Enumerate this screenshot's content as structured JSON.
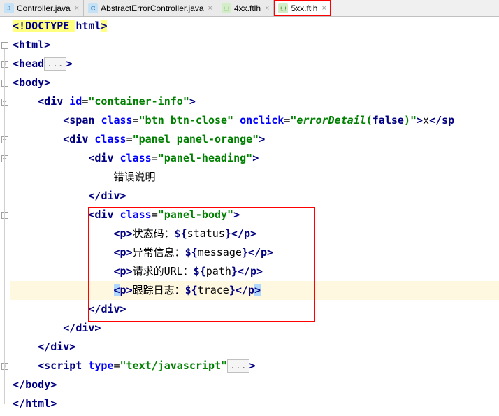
{
  "tabs": [
    {
      "label": "Controller.java",
      "icon": "J",
      "iconClass": "java",
      "active": false,
      "closeable": true
    },
    {
      "label": "AbstractErrorController.java",
      "icon": "C",
      "iconClass": "java",
      "active": false,
      "closeable": true
    },
    {
      "label": "4xx.ftlh",
      "icon": "⬚",
      "iconClass": "ftlh",
      "active": false,
      "closeable": true
    },
    {
      "label": "5xx.ftlh",
      "icon": "⬚",
      "iconClass": "ftlh",
      "active": true,
      "closeable": true,
      "redBox": true
    }
  ],
  "code": {
    "l1_a": "<!DOCTYPE ",
    "l1_b": "html",
    "l1_c": ">",
    "l2_a": "<",
    "l2_b": "html",
    "l2_c": ">",
    "l3_a": "<",
    "l3_b": "head",
    "l3_fold": "...",
    "l3_c": ">",
    "l4_a": "<",
    "l4_b": "body",
    "l4_c": ">",
    "l5_a": "    <",
    "l5_b": "div ",
    "l5_attr": "id",
    "l5_eq": "=",
    "l5_val": "\"container-info\"",
    "l5_c": ">",
    "l6_a": "        <",
    "l6_b": "span ",
    "l6_attr1": "class",
    "l6_eq": "=",
    "l6_val1": "\"btn btn-close\"",
    "l6_sp": " ",
    "l6_attr2": "onclick",
    "l6_val2": "\"",
    "l6_fn": "errorDetail",
    "l6_paren": "(",
    "l6_false": "false",
    "l6_paren2": ")",
    "l6_val2b": "\"",
    "l6_c": ">",
    "l6_txt": "x",
    "l6_d": "</",
    "l6_e": "sp",
    "l7_a": "        <",
    "l7_b": "div ",
    "l7_attr": "class",
    "l7_eq": "=",
    "l7_val": "\"panel panel-orange\"",
    "l7_c": ">",
    "l8_a": "            <",
    "l8_b": "div ",
    "l8_attr": "class",
    "l8_eq": "=",
    "l8_val": "\"panel-heading\"",
    "l8_c": ">",
    "l9_txt": "                错误说明",
    "l10_a": "            </",
    "l10_b": "div",
    "l10_c": ">",
    "l11_a": "            <",
    "l11_b": "div ",
    "l11_attr": "class",
    "l11_eq": "=",
    "l11_val": "\"panel-body\"",
    "l11_c": ">",
    "l12_a": "                <",
    "l12_b": "p",
    "l12_c": ">",
    "l12_txt": "状态码：",
    "l12_var": "${",
    "l12_name": "status",
    "l12_var2": "}",
    "l12_d": "</",
    "l12_e": "p",
    "l12_f": ">",
    "l13_a": "                <",
    "l13_b": "p",
    "l13_c": ">",
    "l13_txt": "异常信息：",
    "l13_var": "${",
    "l13_name": "message",
    "l13_var2": "}",
    "l13_d": "</",
    "l13_e": "p",
    "l13_f": ">",
    "l14_a": "                <",
    "l14_b": "p",
    "l14_c": ">",
    "l14_txt": "请求的URL：",
    "l14_var": "${",
    "l14_name": "path",
    "l14_var2": "}",
    "l14_d": "</",
    "l14_e": "p",
    "l14_f": ">",
    "l15_a": "                ",
    "l15_b": "<",
    "l15_p": "p",
    "l15_c": ">",
    "l15_txt": "跟踪日志：",
    "l15_var": "${",
    "l15_name": "trace",
    "l15_var2": "}",
    "l15_d": "</",
    "l15_e": "p",
    "l15_f": ">",
    "l16_a": "            </",
    "l16_b": "div",
    "l16_c": ">",
    "l17_a": "        </",
    "l17_b": "div",
    "l17_c": ">",
    "l18_a": "    </",
    "l18_b": "div",
    "l18_c": ">",
    "l19_a": "    <",
    "l19_b": "script ",
    "l19_attr": "type",
    "l19_eq": "=",
    "l19_val": "\"text/javascript\"",
    "l19_fold": "...",
    "l19_c": ">",
    "l20_a": "</",
    "l20_b": "body",
    "l20_c": ">",
    "l21_a": "</",
    "l21_b": "html",
    "l21_c": ">"
  }
}
